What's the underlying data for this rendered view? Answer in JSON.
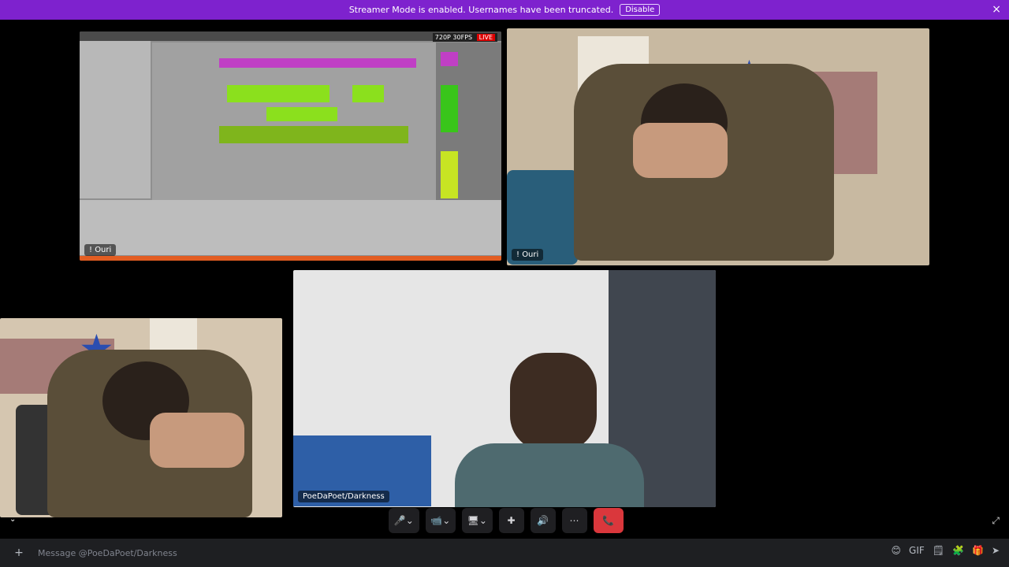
{
  "banner": {
    "message": "Streamer Mode is enabled. Usernames have been truncated.",
    "disable_label": "Disable",
    "close_icon": "×"
  },
  "tiles": {
    "daw": {
      "name": "! Ouri",
      "badge_res": "720P 30FPS",
      "badge_live": "LIVE"
    },
    "cam1": {
      "name": "! Ouri"
    },
    "cam3": {
      "name": "PoeDaPoet/Darkness"
    }
  },
  "controls": {
    "mic_icon": "🎤",
    "caret": "⌄",
    "camera_icon": "📹",
    "screen_icon": "🖥",
    "activities_icon": "✚",
    "soundboard_icon": "🔊",
    "more_icon": "⋯",
    "leave_icon": "📞"
  },
  "message": {
    "placeholder": "Message @PoeDaPoet/Darkness",
    "add_icon": "+",
    "icons": [
      "😊",
      "GIF",
      "🗒",
      "🧩",
      "🎁",
      "➤"
    ]
  },
  "misc": {
    "collapse_icon": "⌄",
    "fullscreen_icon": "⤢"
  },
  "colors": {
    "banner": "#7e22ce",
    "end_call": "#da373c"
  }
}
